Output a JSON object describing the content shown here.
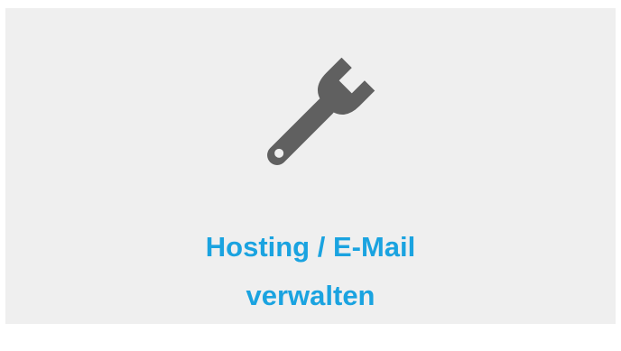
{
  "tile": {
    "icon": "wrench-icon",
    "title_line1": "Hosting / E-Mail",
    "title_line2": "verwalten"
  },
  "colors": {
    "tile_background": "#efefef",
    "accent": "#1aa3e0",
    "icon": "#606060"
  }
}
